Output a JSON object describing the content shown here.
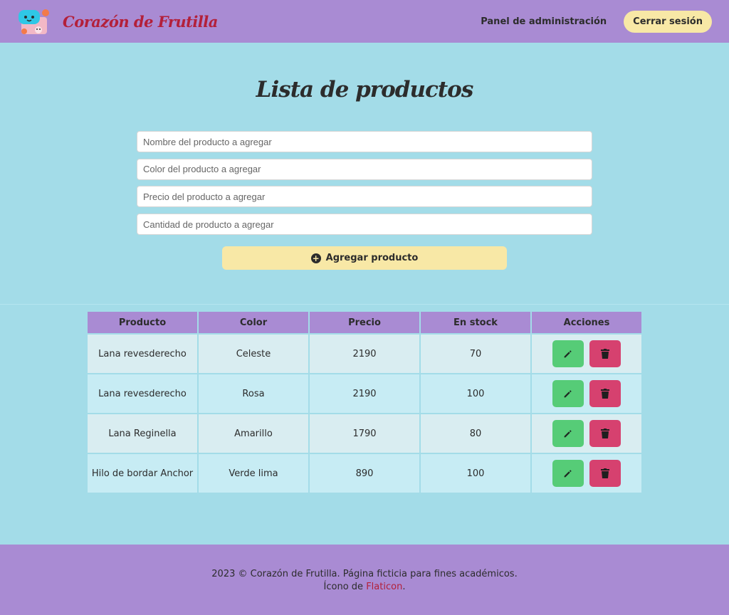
{
  "navbar": {
    "brand": "Corazón de Frutilla",
    "admin_link": "Panel de administración",
    "logout_label": "Cerrar sesión"
  },
  "main": {
    "title": "Lista de productos",
    "form": {
      "name_placeholder": "Nombre del producto a agregar",
      "color_placeholder": "Color del producto a agregar",
      "price_placeholder": "Precio del producto a agregar",
      "qty_placeholder": "Cantidad de producto a agregar",
      "add_label": "Agregar producto"
    }
  },
  "table": {
    "headers": [
      "Producto",
      "Color",
      "Precio",
      "En stock",
      "Acciones"
    ],
    "rows": [
      {
        "product": "Lana revesderecho",
        "color": "Celeste",
        "price": "2190",
        "stock": "70"
      },
      {
        "product": "Lana revesderecho",
        "color": "Rosa",
        "price": "2190",
        "stock": "100"
      },
      {
        "product": "Lana Reginella",
        "color": "Amarillo",
        "price": "1790",
        "stock": "80"
      },
      {
        "product": "Hilo de bordar Anchor",
        "color": "Verde lima",
        "price": "890",
        "stock": "100"
      }
    ]
  },
  "footer": {
    "line1": "2023 © Corazón de Frutilla. Página ficticia para fines académicos.",
    "line2_prefix": "Ícono de ",
    "line2_link": "Flaticon",
    "line2_suffix": "."
  },
  "icons": {
    "add": "plus-circle-icon",
    "edit": "pencil-icon",
    "delete": "trash-icon"
  },
  "colors": {
    "navbar": "#a98bd3",
    "background": "#a3dce8",
    "button_yellow": "#f8e8a6",
    "brand_red": "#b3203a",
    "edit_green": "#56cc77",
    "delete_pink": "#d6416f"
  }
}
